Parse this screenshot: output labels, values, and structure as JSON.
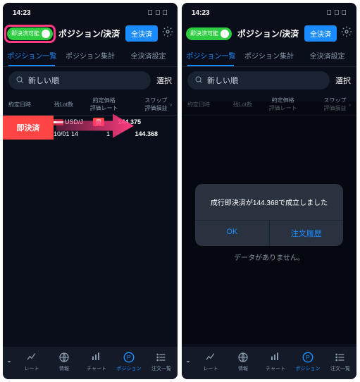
{
  "status": {
    "time": "14:23"
  },
  "header": {
    "toggle_label": "即決済可能",
    "title": "ポジション/決済",
    "settle_all": "全決済"
  },
  "tabs": [
    "ポジション一覧",
    "ポジション集計",
    "全決済設定"
  ],
  "search": {
    "placeholder": "新しい順",
    "select": "選択"
  },
  "table_headers": {
    "datetime": "約定日時",
    "lot": "残Lot数",
    "rate": "約定価格\n評価レート",
    "swap": "スワップ\n評価損益"
  },
  "swipe_label": "即決済",
  "rows": [
    {
      "pair": "USD/J",
      "lot": "",
      "side": "買",
      "rate": "144.375"
    },
    {
      "pair": "10/01 14",
      "lot": "1",
      "side": "",
      "rate": "144.368"
    }
  ],
  "nav": [
    "レート",
    "情報",
    "チャート",
    "ポジション",
    "注文一覧"
  ],
  "modal": {
    "message": "成行即決済が144.368で成立しました",
    "ok": "OK",
    "history": "注文履歴"
  },
  "no_data": "データがありません。"
}
